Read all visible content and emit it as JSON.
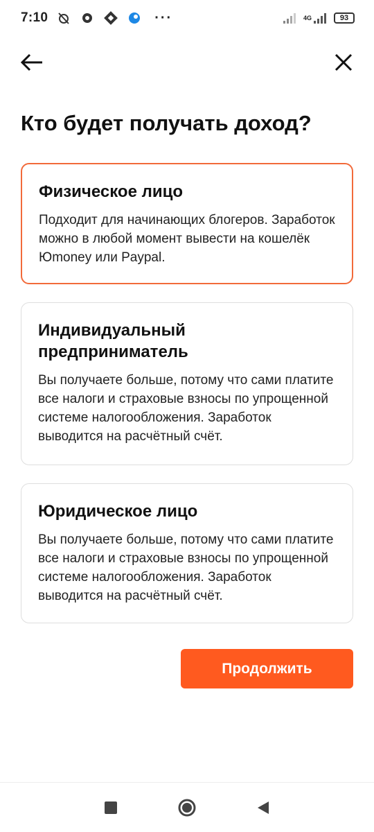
{
  "status_bar": {
    "time": "7:10",
    "more": "···",
    "network": "4G",
    "battery": "93"
  },
  "nav": {
    "back_icon": "arrow-left-icon",
    "close_icon": "close-icon"
  },
  "title": "Кто будет получать доход?",
  "options": [
    {
      "title": "Физическое лицо",
      "description": "Подходит для начинающих блогеров. Заработок можно в любой момент вывести на кошелёк Юmoney или Paypal.",
      "selected": true
    },
    {
      "title": "Индивидуальный предприниматель",
      "description": "Вы получаете больше, потому что сами платите все налоги и страховые взносы по упрощенной системе налогообложения. Заработок выводится на расчётный счёт.",
      "selected": false
    },
    {
      "title": "Юридическое лицо",
      "description": "Вы получаете больше, потому что сами платите все налоги и страховые взносы по упрощенной системе налогообложения. Заработок выводится на расчётный счёт.",
      "selected": false
    }
  ],
  "continue_label": "Продолжить",
  "colors": {
    "accent": "#ff5a1f",
    "selected_border": "#f26a3a"
  }
}
